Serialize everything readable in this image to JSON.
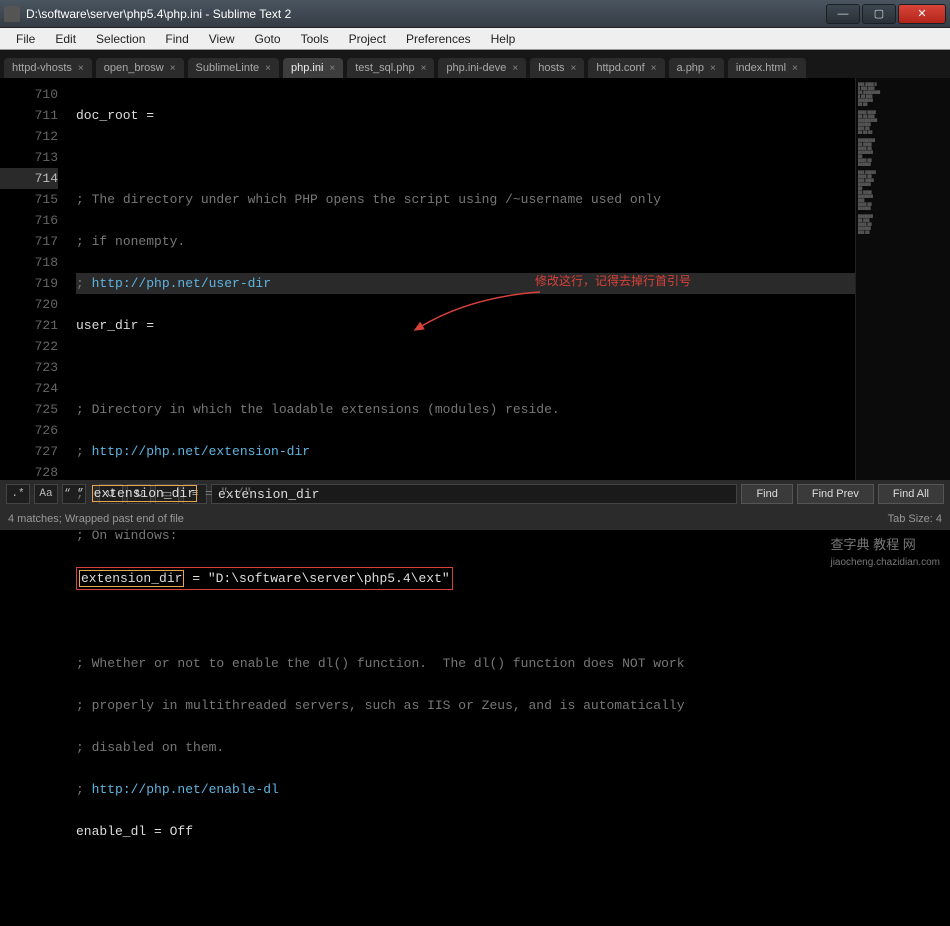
{
  "titlebar": {
    "path": "D:\\software\\server\\php5.4\\php.ini - Sublime Text 2"
  },
  "menu": {
    "items": [
      "File",
      "Edit",
      "Selection",
      "Find",
      "View",
      "Goto",
      "Tools",
      "Project",
      "Preferences",
      "Help"
    ]
  },
  "tabs": [
    {
      "label": "httpd-vhosts",
      "active": false
    },
    {
      "label": "open_brosw",
      "active": false
    },
    {
      "label": "SublimeLinte",
      "active": false
    },
    {
      "label": "php.ini",
      "active": true
    },
    {
      "label": "test_sql.php",
      "active": false
    },
    {
      "label": "php.ini-deve",
      "active": false
    },
    {
      "label": "hosts",
      "active": false
    },
    {
      "label": "httpd.conf",
      "active": false
    },
    {
      "label": "a.php",
      "active": false
    },
    {
      "label": "index.html",
      "active": false
    }
  ],
  "gutter": {
    "start": 710,
    "lines": [
      "710",
      "711",
      "712",
      "713",
      "714",
      "715",
      "716",
      "717",
      "718",
      "719",
      "720",
      "721",
      "722",
      "723",
      "724",
      "725",
      "726",
      "727",
      "728"
    ]
  },
  "code": {
    "l710": "doc_root =",
    "l712_pre": "; ",
    "l712": "The directory under which PHP opens the script using /~username used only",
    "l713_pre": "; ",
    "l713": "if nonempty.",
    "l714_pre": "; ",
    "l714_url": "http://php.net/user-dir",
    "l715": "user_dir =",
    "l717_pre": "; ",
    "l717": "Directory in which the loadable extensions (modules) reside.",
    "l718_pre": "; ",
    "l718_url": "http://php.net/extension-dir",
    "l719_pre": "; ",
    "l719_key": "extension_dir",
    "l719_rest": " = \"./\"",
    "l720_pre": "; ",
    "l720": "On windows:",
    "l721_key": "extension_dir",
    "l721_rest": " = \"D:\\software\\server\\php5.4\\ext\"",
    "l723_pre": "; ",
    "l723": "Whether or not to enable the dl() function.  The dl() function does NOT work",
    "l724_pre": "; ",
    "l724": "properly in multithreaded servers, such as IIS or Zeus, and is automatically",
    "l725_pre": "; ",
    "l725": "disabled on them.",
    "l726_pre": "; ",
    "l726_url": "http://php.net/enable-dl",
    "l727": "enable_dl = Off"
  },
  "annotation": {
    "text": "修改这行，记得去掉行首引号"
  },
  "find": {
    "opt_regex": ".*",
    "opt_case": "Aa",
    "opt_word": "“ ”",
    "opt_reverse": "↺",
    "opt_wrap": "↻",
    "opt_sel": "▭",
    "opt_hl": "≡",
    "value": "extension_dir",
    "btn_find": "Find",
    "btn_prev": "Find Prev",
    "btn_all": "Find All"
  },
  "status": {
    "left": "4 matches; Wrapped past end of file",
    "right": "Tab Size: 4"
  },
  "watermark": {
    "text": "查字典 教程 网",
    "sub": "jiaocheng.chazidian.com"
  }
}
